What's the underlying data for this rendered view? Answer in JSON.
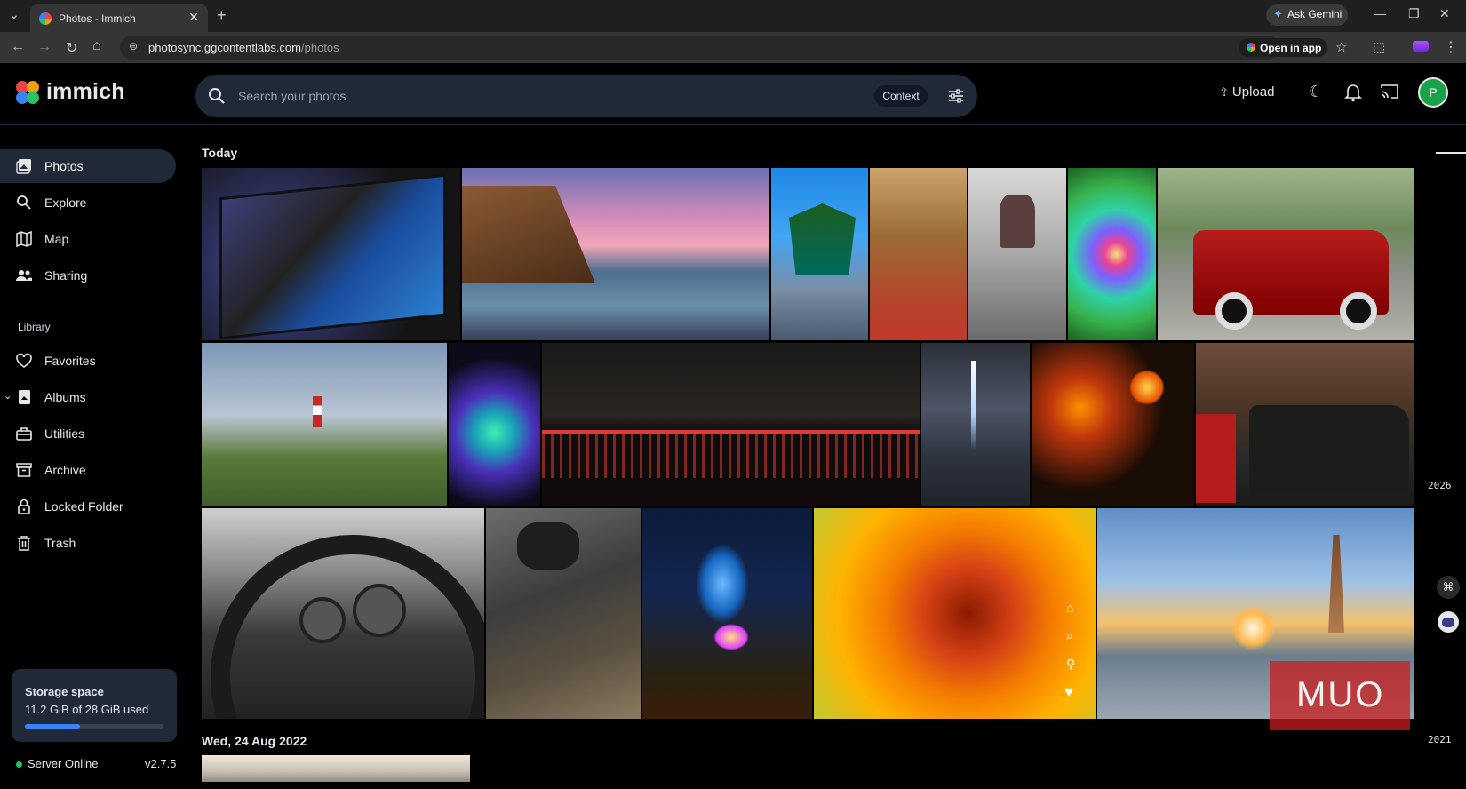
{
  "browser": {
    "tab_title": "Photos - Immich",
    "url_host": "photosync.ggcontentlabs.com",
    "url_path": "/photos",
    "ask_gemini": "Ask Gemini",
    "open_in_app": "Open in app"
  },
  "header": {
    "brand": "immich",
    "search_placeholder": "Search your photos",
    "context_label": "Context",
    "upload_label": "Upload",
    "avatar_initial": "P"
  },
  "sidebar": {
    "items": [
      {
        "label": "Photos",
        "icon": "photos-icon",
        "active": true
      },
      {
        "label": "Explore",
        "icon": "explore-icon"
      },
      {
        "label": "Map",
        "icon": "map-icon"
      },
      {
        "label": "Sharing",
        "icon": "sharing-icon"
      }
    ],
    "library_header": "Library",
    "library_items": [
      {
        "label": "Favorites",
        "icon": "heart-icon"
      },
      {
        "label": "Albums",
        "icon": "albums-icon"
      },
      {
        "label": "Utilities",
        "icon": "utilities-icon"
      },
      {
        "label": "Archive",
        "icon": "archive-icon"
      },
      {
        "label": "Locked Folder",
        "icon": "lock-icon"
      },
      {
        "label": "Trash",
        "icon": "trash-icon"
      }
    ],
    "storage": {
      "title": "Storage space",
      "usage": "11.2 GiB of 28 GiB used",
      "used_fraction": 0.4
    },
    "server_status": "Server Online",
    "version": "v2.7.5"
  },
  "timeline": {
    "groups": [
      {
        "date": "Today"
      },
      {
        "date": "Wed, 24 Aug 2022"
      }
    ],
    "scrubber_years": [
      "2026",
      "2021"
    ]
  },
  "watermark": "MUO",
  "colors": {
    "accent": "#3b82f6",
    "avatar": "#16a34a",
    "online": "#22c55e"
  }
}
